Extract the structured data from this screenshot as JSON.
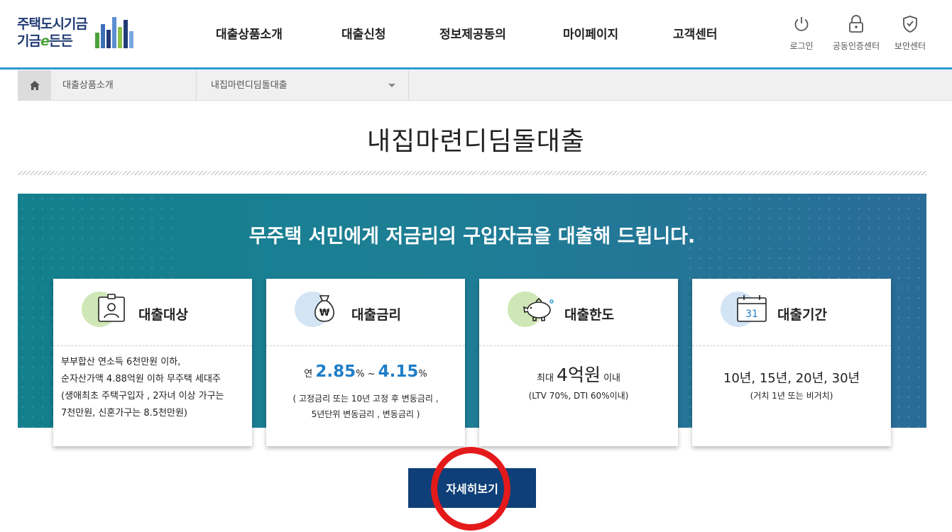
{
  "header": {
    "logo": {
      "line1": "주택도시기금",
      "line2_a": "기금",
      "line2_e": "e",
      "line2_b": "든든"
    },
    "nav": [
      "대출상품소개",
      "대출신청",
      "정보제공동의",
      "마이페이지",
      "고객센터"
    ],
    "utils": [
      {
        "label": "로그인",
        "icon": "power-icon"
      },
      {
        "label": "공동인증센터",
        "icon": "lock-icon"
      },
      {
        "label": "보안센터",
        "icon": "shield-icon"
      }
    ]
  },
  "breadcrumb": {
    "home_icon": "home-icon",
    "level1": "대출상품소개",
    "level2": "내집마련디딤돌대출"
  },
  "page": {
    "title": "내집마련디딤돌대출"
  },
  "banner": {
    "headline": "무주택 서민에게 저금리의 구입자금을 대출해 드립니다."
  },
  "cards": {
    "target": {
      "title": "대출대상",
      "icon": "id-card-icon",
      "lines": [
        "부부합산 연소득 6천만원 이하,",
        "순자산가액 4.88억원 이하 무주택 세대주",
        "(생애최초 주택구입자 , 2자녀 이상 가구는",
        "7천만원, 신혼가구는 8.5천만원)"
      ]
    },
    "rate": {
      "title": "대출금리",
      "icon": "money-bag-icon",
      "prefix": "연",
      "low": "2.85",
      "unit1": "%",
      "tilde": "~",
      "high": "4.15",
      "unit2": "%",
      "note1": "( 고정금리 또는 10년 고정 후 변동금리 ,",
      "note2": "5년단위 변동금리 , 변동금리 )"
    },
    "limit": {
      "title": "대출한도",
      "icon": "piggy-bank-icon",
      "prefix": "최대",
      "amount": "4억원",
      "suffix": "이내",
      "note": "(LTV 70%, DTI 60%이내)"
    },
    "term": {
      "title": "대출기간",
      "icon": "calendar-icon",
      "calendar_day": "31",
      "value": "10년, 15년, 20년, 30년",
      "note": "(거치 1년 또는 비거치)"
    }
  },
  "detail_button": {
    "label": "자세히보기"
  },
  "colors": {
    "brand_navy": "#0f3f78",
    "accent_blue": "#1f7ec7",
    "header_line": "#2b9bd0",
    "banner_teal": "#137f8c",
    "highlight_ring": "#e41a1a"
  }
}
